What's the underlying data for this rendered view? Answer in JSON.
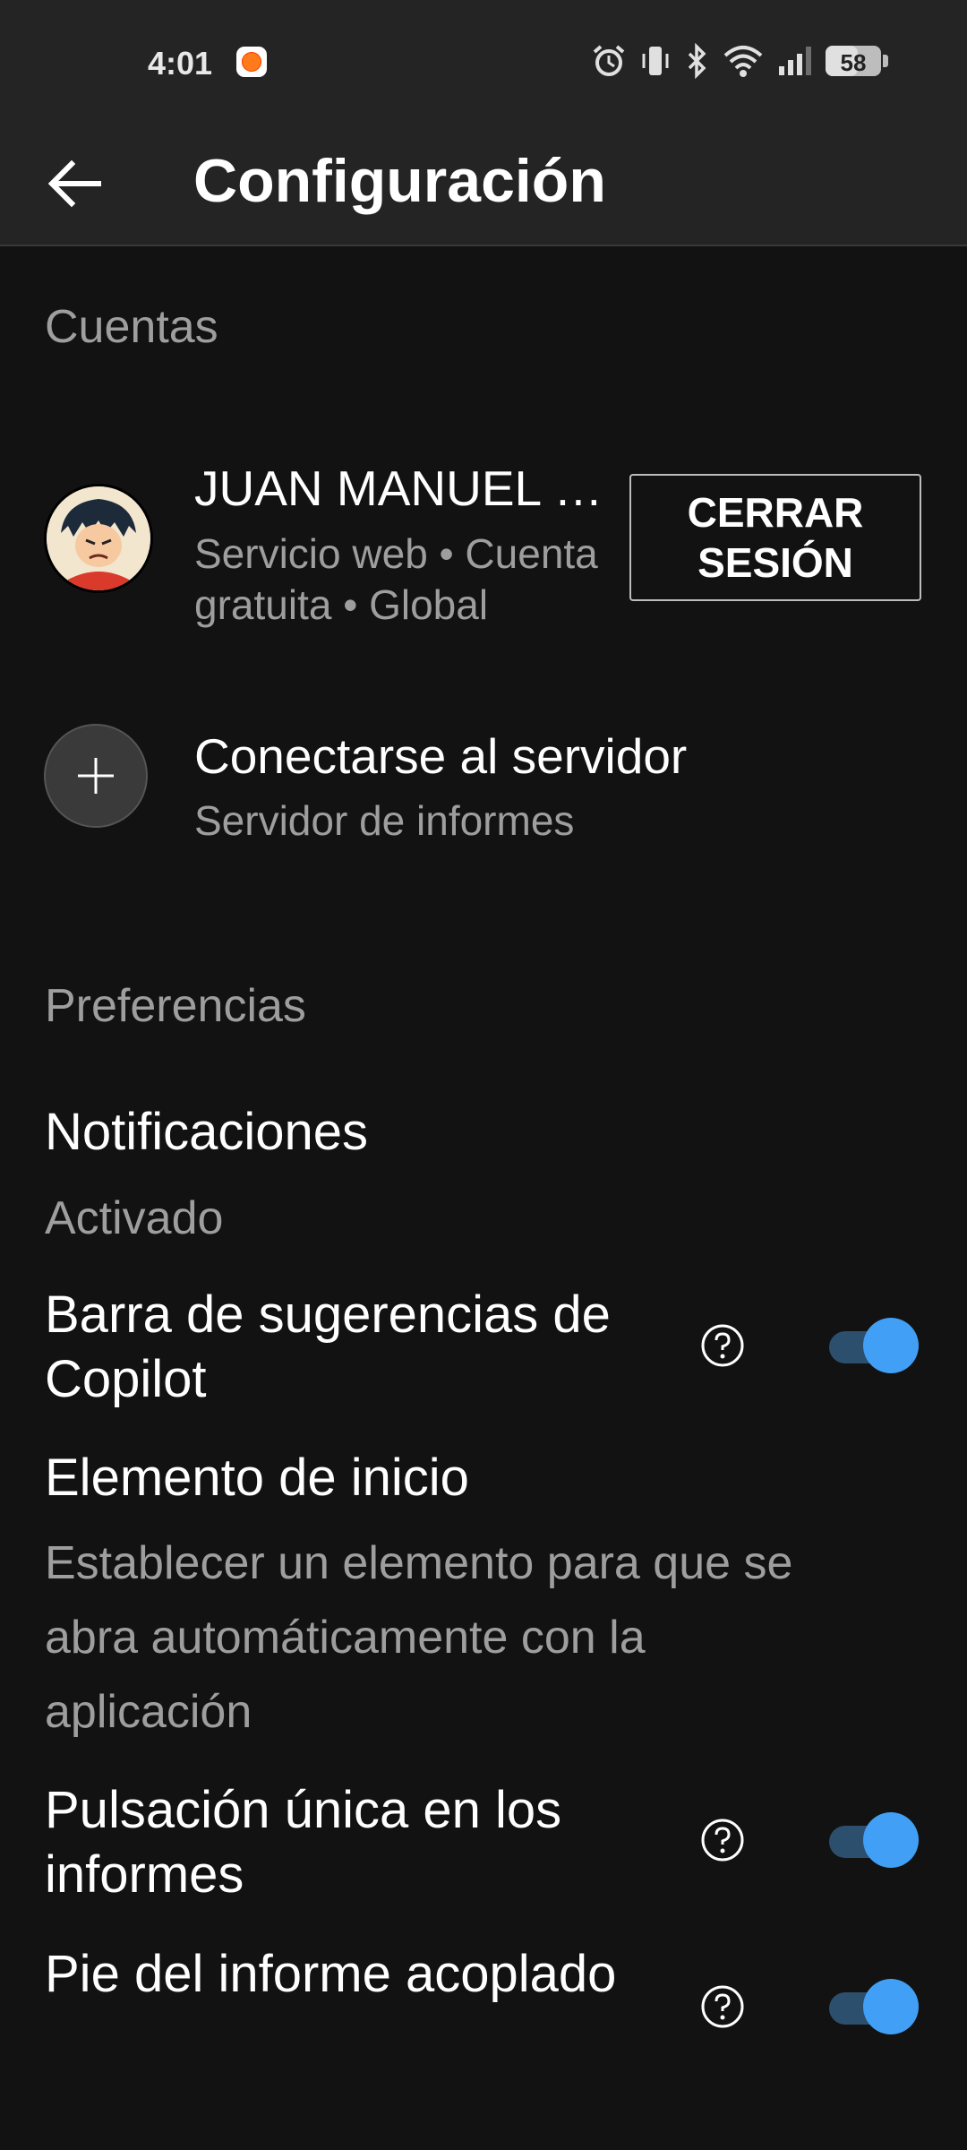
{
  "status_bar": {
    "time": "4:01",
    "battery": "58",
    "battery_level": 0.58
  },
  "app_bar": {
    "title": "Configuración"
  },
  "accounts": {
    "section_title": "Cuentas",
    "account": {
      "name": "JUAN MANUEL …",
      "description": "Servicio web • Cuenta gratuita • Global",
      "sign_out_label": "CERRAR SESIÓN"
    },
    "connect": {
      "title": "Conectarse al servidor",
      "subtitle": "Servidor de informes"
    }
  },
  "preferences": {
    "section_title": "Preferencias",
    "notifications": {
      "title": "Notificaciones",
      "value": "Activado"
    },
    "copilot_bar": {
      "title": "Barra de sugerencias de Copilot",
      "enabled": true
    },
    "start_item": {
      "title": "Elemento de inicio",
      "description": "Establecer un elemento para que se abra automáticamente con la aplicación"
    },
    "single_tap": {
      "title": "Pulsación única en los informes",
      "enabled": true
    },
    "docked_footer": {
      "title": "Pie del informe acoplado",
      "enabled": true
    }
  },
  "colors": {
    "accent": "#41a0f5",
    "track": "#2d4f6e",
    "background": "#121212",
    "bar": "#242424"
  }
}
